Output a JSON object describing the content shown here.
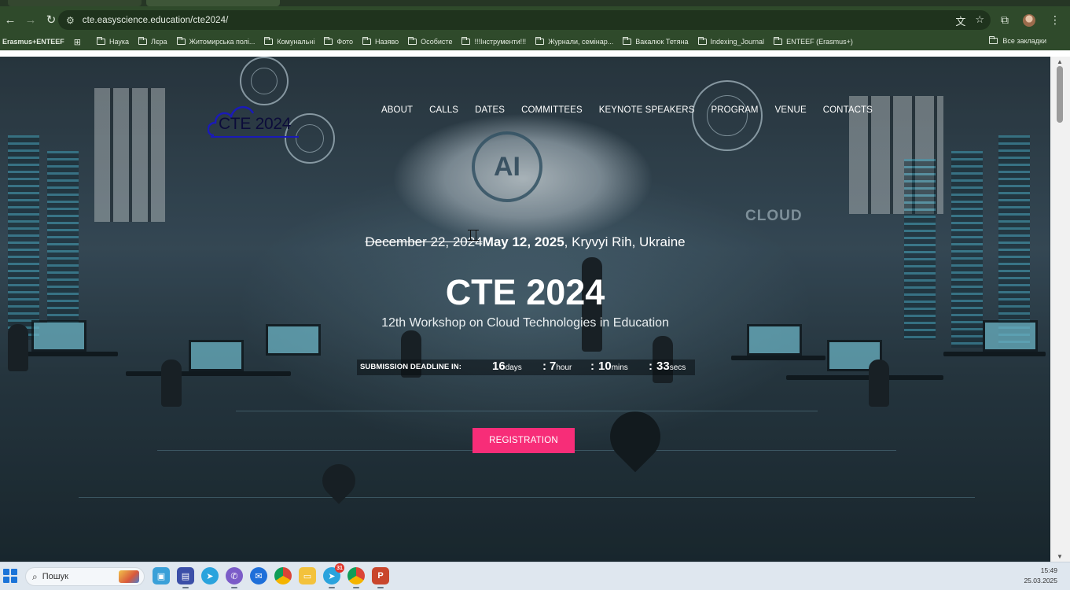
{
  "browser": {
    "url": "cte.easyscience.education/cte2024/",
    "bookmarks_first": "Erasmus+ENTEEF",
    "bookmarks": [
      "Наука",
      "Лєра",
      "Житомирська полі...",
      "Комунальні",
      "Фото",
      "Назяво",
      "Особисте",
      "!!!Інструменти!!!",
      "Журнали, семінар...",
      "Вакалюк Тетяна",
      "Indexing_Journal",
      "ENTEEF (Erasmus+)"
    ],
    "all_bookmarks": "Все закладки"
  },
  "site": {
    "logo_text": "CTE 2024",
    "nav": [
      "ABOUT",
      "CALLS",
      "DATES",
      "COMMITTEES",
      "KEYNOTE SPEAKERS",
      "PROGRAM",
      "VENUE",
      "CONTACTS"
    ],
    "date_old": "December 22, 2024",
    "date_new": "May 12, 2025",
    "location": ", Kryvyi Rih, Ukraine",
    "title": "CTE 2024",
    "subtitle": "12th Workshop on Cloud Technologies in Education",
    "countdown": {
      "label": "SUBMISSION DEADLINE IN:",
      "days": "16",
      "days_unit": "days",
      "hours": "7",
      "hours_unit": "hour",
      "mins": "10",
      "mins_unit": "mins",
      "secs": "33",
      "secs_unit": "secs",
      "sep": ":"
    },
    "registration": "REGISTRATION",
    "image_text": {
      "ai": "AI",
      "cloud": "CLOUD"
    }
  },
  "taskbar": {
    "search_placeholder": "Пошук",
    "telegram_badge": "31",
    "time": "15:49",
    "date": "25.03.2025"
  },
  "colors": {
    "browser_chrome": "#2f4a2b",
    "registration_button": "#f72d78",
    "taskbar": "#dfe7ef"
  }
}
